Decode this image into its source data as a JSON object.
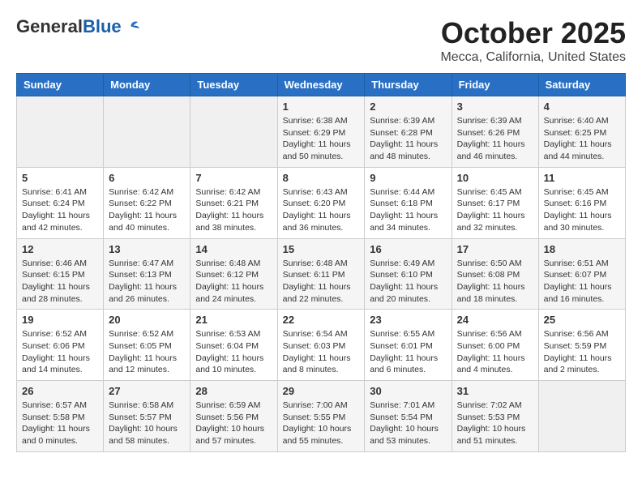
{
  "header": {
    "logo": {
      "general": "General",
      "blue": "Blue"
    },
    "month_title": "October 2025",
    "location": "Mecca, California, United States"
  },
  "weekdays": [
    "Sunday",
    "Monday",
    "Tuesday",
    "Wednesday",
    "Thursday",
    "Friday",
    "Saturday"
  ],
  "weeks": [
    [
      {
        "day": "",
        "info": ""
      },
      {
        "day": "",
        "info": ""
      },
      {
        "day": "",
        "info": ""
      },
      {
        "day": "1",
        "info": "Sunrise: 6:38 AM\nSunset: 6:29 PM\nDaylight: 11 hours and 50 minutes."
      },
      {
        "day": "2",
        "info": "Sunrise: 6:39 AM\nSunset: 6:28 PM\nDaylight: 11 hours and 48 minutes."
      },
      {
        "day": "3",
        "info": "Sunrise: 6:39 AM\nSunset: 6:26 PM\nDaylight: 11 hours and 46 minutes."
      },
      {
        "day": "4",
        "info": "Sunrise: 6:40 AM\nSunset: 6:25 PM\nDaylight: 11 hours and 44 minutes."
      }
    ],
    [
      {
        "day": "5",
        "info": "Sunrise: 6:41 AM\nSunset: 6:24 PM\nDaylight: 11 hours and 42 minutes."
      },
      {
        "day": "6",
        "info": "Sunrise: 6:42 AM\nSunset: 6:22 PM\nDaylight: 11 hours and 40 minutes."
      },
      {
        "day": "7",
        "info": "Sunrise: 6:42 AM\nSunset: 6:21 PM\nDaylight: 11 hours and 38 minutes."
      },
      {
        "day": "8",
        "info": "Sunrise: 6:43 AM\nSunset: 6:20 PM\nDaylight: 11 hours and 36 minutes."
      },
      {
        "day": "9",
        "info": "Sunrise: 6:44 AM\nSunset: 6:18 PM\nDaylight: 11 hours and 34 minutes."
      },
      {
        "day": "10",
        "info": "Sunrise: 6:45 AM\nSunset: 6:17 PM\nDaylight: 11 hours and 32 minutes."
      },
      {
        "day": "11",
        "info": "Sunrise: 6:45 AM\nSunset: 6:16 PM\nDaylight: 11 hours and 30 minutes."
      }
    ],
    [
      {
        "day": "12",
        "info": "Sunrise: 6:46 AM\nSunset: 6:15 PM\nDaylight: 11 hours and 28 minutes."
      },
      {
        "day": "13",
        "info": "Sunrise: 6:47 AM\nSunset: 6:13 PM\nDaylight: 11 hours and 26 minutes."
      },
      {
        "day": "14",
        "info": "Sunrise: 6:48 AM\nSunset: 6:12 PM\nDaylight: 11 hours and 24 minutes."
      },
      {
        "day": "15",
        "info": "Sunrise: 6:48 AM\nSunset: 6:11 PM\nDaylight: 11 hours and 22 minutes."
      },
      {
        "day": "16",
        "info": "Sunrise: 6:49 AM\nSunset: 6:10 PM\nDaylight: 11 hours and 20 minutes."
      },
      {
        "day": "17",
        "info": "Sunrise: 6:50 AM\nSunset: 6:08 PM\nDaylight: 11 hours and 18 minutes."
      },
      {
        "day": "18",
        "info": "Sunrise: 6:51 AM\nSunset: 6:07 PM\nDaylight: 11 hours and 16 minutes."
      }
    ],
    [
      {
        "day": "19",
        "info": "Sunrise: 6:52 AM\nSunset: 6:06 PM\nDaylight: 11 hours and 14 minutes."
      },
      {
        "day": "20",
        "info": "Sunrise: 6:52 AM\nSunset: 6:05 PM\nDaylight: 11 hours and 12 minutes."
      },
      {
        "day": "21",
        "info": "Sunrise: 6:53 AM\nSunset: 6:04 PM\nDaylight: 11 hours and 10 minutes."
      },
      {
        "day": "22",
        "info": "Sunrise: 6:54 AM\nSunset: 6:03 PM\nDaylight: 11 hours and 8 minutes."
      },
      {
        "day": "23",
        "info": "Sunrise: 6:55 AM\nSunset: 6:01 PM\nDaylight: 11 hours and 6 minutes."
      },
      {
        "day": "24",
        "info": "Sunrise: 6:56 AM\nSunset: 6:00 PM\nDaylight: 11 hours and 4 minutes."
      },
      {
        "day": "25",
        "info": "Sunrise: 6:56 AM\nSunset: 5:59 PM\nDaylight: 11 hours and 2 minutes."
      }
    ],
    [
      {
        "day": "26",
        "info": "Sunrise: 6:57 AM\nSunset: 5:58 PM\nDaylight: 11 hours and 0 minutes."
      },
      {
        "day": "27",
        "info": "Sunrise: 6:58 AM\nSunset: 5:57 PM\nDaylight: 10 hours and 58 minutes."
      },
      {
        "day": "28",
        "info": "Sunrise: 6:59 AM\nSunset: 5:56 PM\nDaylight: 10 hours and 57 minutes."
      },
      {
        "day": "29",
        "info": "Sunrise: 7:00 AM\nSunset: 5:55 PM\nDaylight: 10 hours and 55 minutes."
      },
      {
        "day": "30",
        "info": "Sunrise: 7:01 AM\nSunset: 5:54 PM\nDaylight: 10 hours and 53 minutes."
      },
      {
        "day": "31",
        "info": "Sunrise: 7:02 AM\nSunset: 5:53 PM\nDaylight: 10 hours and 51 minutes."
      },
      {
        "day": "",
        "info": ""
      }
    ]
  ]
}
